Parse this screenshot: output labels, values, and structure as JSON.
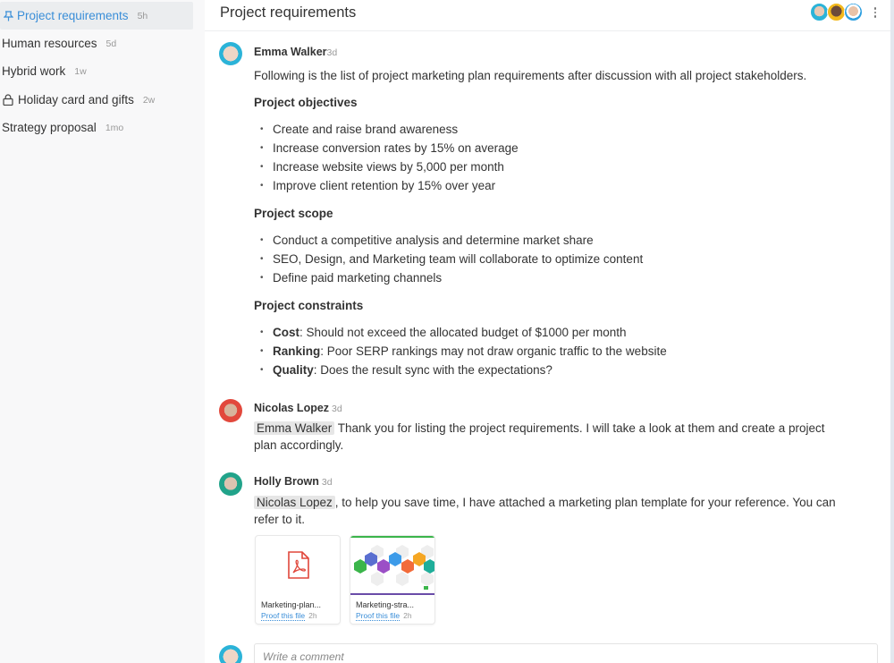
{
  "sidebar": {
    "items": [
      {
        "label": "Project requirements",
        "age": "5h",
        "icon": "pin-icon",
        "active": true
      },
      {
        "label": "Human resources",
        "age": "5d"
      },
      {
        "label": "Hybrid work",
        "age": "1w"
      },
      {
        "label": "Holiday card and gifts",
        "age": "2w",
        "icon": "lock-icon"
      },
      {
        "label": "Strategy proposal",
        "age": "1mo"
      }
    ]
  },
  "header": {
    "title": "Project requirements",
    "participants": [
      "Emma Walker",
      "Nicolas Lopez",
      "Holly Brown"
    ],
    "more_icon": "more-vertical-icon"
  },
  "colors": {
    "accent": "#3a8ed8",
    "pdf_red": "#e0463a",
    "sidebar_bg": "#f8f8f9",
    "active_bg": "#ebedef"
  },
  "messages": [
    {
      "author": "Emma Walker",
      "time": "3d",
      "intro": "Following is the list of project marketing plan requirements after discussion with all project stakeholders.",
      "sections": [
        {
          "heading": "Project objectives",
          "items": [
            "Create and raise brand awareness",
            "Increase conversion rates by 15% on average",
            "Increase website views by 5,000 per month",
            "Improve client retention by 15% over year"
          ]
        },
        {
          "heading": "Project scope",
          "items": [
            "Conduct a competitive analysis and determine market share",
            "SEO, Design, and Marketing team will collaborate to optimize content",
            "Define paid marketing channels"
          ]
        },
        {
          "heading": "Project constraints",
          "items": [
            {
              "bold": "Cost",
              "text": ": Should not exceed the allocated budget of $1000 per month"
            },
            {
              "bold": "Ranking",
              "text": ": Poor SERP rankings may not draw organic traffic to the website"
            },
            {
              "bold": "Quality",
              "text": ": Does the result sync with the expectations?"
            }
          ]
        }
      ]
    },
    {
      "author": "Nicolas Lopez",
      "time": "3d",
      "mention": "Emma Walker",
      "text_line1": " Thank you for listing the project requirements. I will take a look at them and create a project",
      "text_line2": "plan accordingly."
    },
    {
      "author": "Holly Brown",
      "time": "3d",
      "mention": "Nicolas Lopez",
      "text_line1": ", to help you save time, I have attached a marketing plan template for your reference. You can",
      "text_line2": "refer to it.",
      "attachments": [
        {
          "name": "Marketing-plan...",
          "action": "Proof this file",
          "age": "2h",
          "type": "pdf"
        },
        {
          "name": "Marketing-stra...",
          "action": "Proof this file",
          "age": "2h",
          "type": "image"
        }
      ]
    }
  ],
  "comment": {
    "placeholder": "Write a comment",
    "value": ""
  }
}
